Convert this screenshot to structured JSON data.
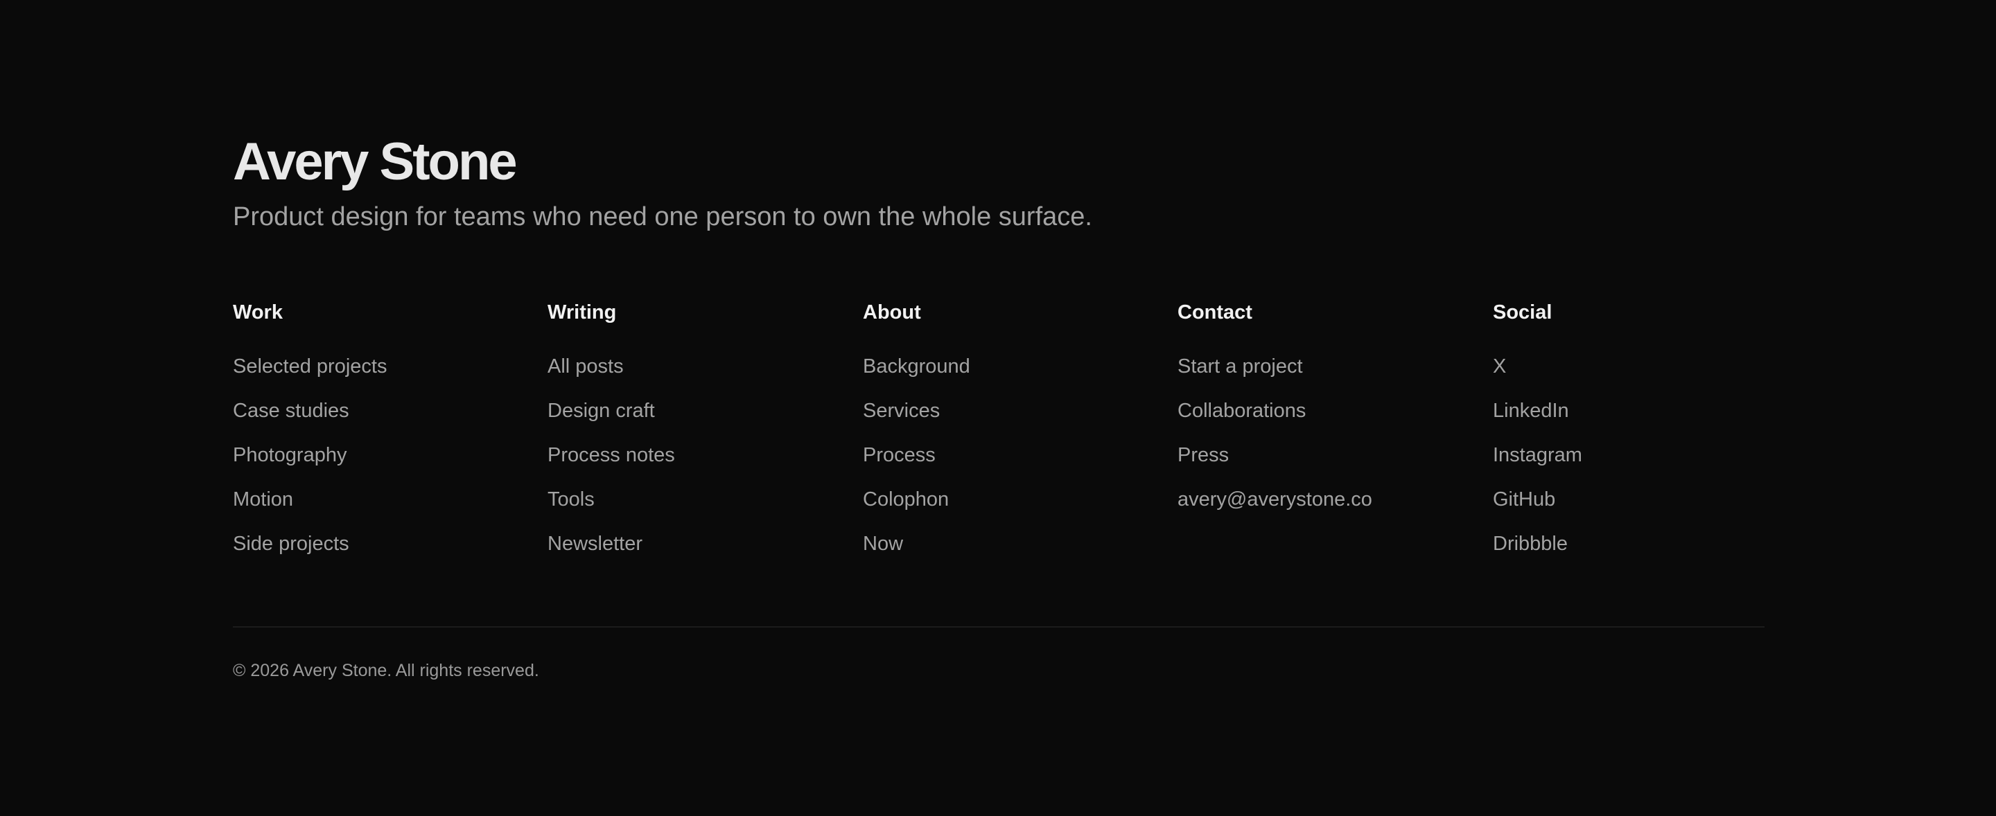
{
  "brand": {
    "name": "Avery Stone",
    "tagline": "Product design for teams who need one person to own the whole surface."
  },
  "columns": [
    {
      "heading": "Work",
      "links": [
        "Selected projects",
        "Case studies",
        "Photography",
        "Motion",
        "Side projects"
      ]
    },
    {
      "heading": "Writing",
      "links": [
        "All posts",
        "Design craft",
        "Process notes",
        "Tools",
        "Newsletter"
      ]
    },
    {
      "heading": "About",
      "links": [
        "Background",
        "Services",
        "Process",
        "Colophon",
        "Now"
      ]
    },
    {
      "heading": "Contact",
      "links": [
        "Start a project",
        "Collaborations",
        "Press",
        "avery@averystone.co"
      ]
    },
    {
      "heading": "Social",
      "links": [
        "X",
        "LinkedIn",
        "Instagram",
        "GitHub",
        "Dribbble"
      ]
    }
  ],
  "footer": {
    "copyright": "© 2026 Avery Stone. All rights reserved."
  },
  "colors": {
    "background": "#0a0a0a",
    "heading": "#f2f2f2",
    "link": "#a3a3a3",
    "divider": "#1c1c1c"
  }
}
